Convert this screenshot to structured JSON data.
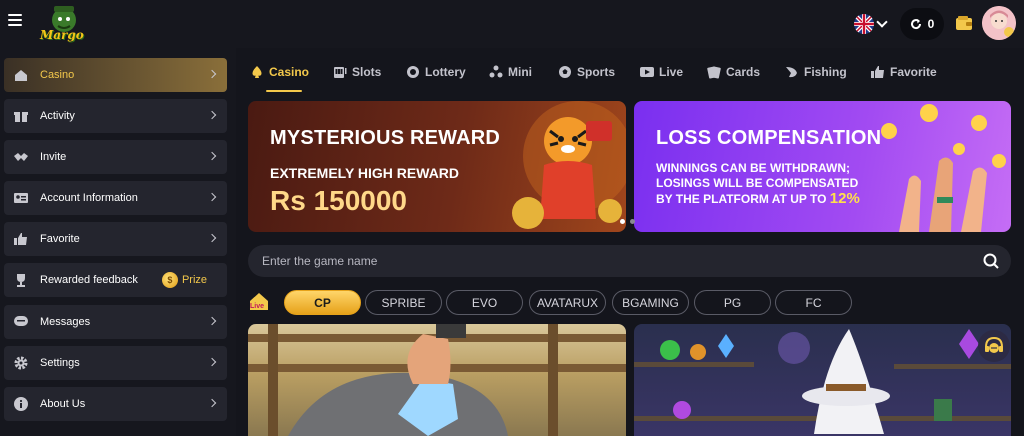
{
  "header": {
    "logo_text": "Margo",
    "language": "en-GB",
    "balance": "0"
  },
  "sidebar": {
    "items": [
      {
        "label": "Casino",
        "icon": "home-icon",
        "active": true
      },
      {
        "label": "Activity",
        "icon": "gift-icon"
      },
      {
        "label": "Invite",
        "icon": "handshake-icon"
      },
      {
        "label": "Account Information",
        "icon": "id-card-icon"
      },
      {
        "label": "Favorite",
        "icon": "thumbs-up-icon"
      },
      {
        "label": "Rewarded feedback",
        "icon": "trophy-icon",
        "badge": "Prize"
      },
      {
        "label": "Messages",
        "icon": "message-icon"
      },
      {
        "label": "Settings",
        "icon": "gear-icon"
      },
      {
        "label": "About Us",
        "icon": "info-icon"
      }
    ]
  },
  "categories": [
    {
      "label": "Casino",
      "icon": "spade-icon",
      "active": true
    },
    {
      "label": "Slots",
      "icon": "slot-machine-icon"
    },
    {
      "label": "Lottery",
      "icon": "lottery-ball-icon"
    },
    {
      "label": "Mini",
      "icon": "mini-games-icon"
    },
    {
      "label": "Sports",
      "icon": "soccer-ball-icon"
    },
    {
      "label": "Live",
      "icon": "live-video-icon"
    },
    {
      "label": "Cards",
      "icon": "cards-icon"
    },
    {
      "label": "Fishing",
      "icon": "fish-icon"
    },
    {
      "label": "Favorite",
      "icon": "thumbs-up-icon"
    }
  ],
  "banners": {
    "b1": {
      "title": "MYSTERIOUS REWARD",
      "subtitle": "EXTREMELY HIGH REWARD",
      "amount": "Rs 150000"
    },
    "b2": {
      "title": "LOSS COMPENSATION",
      "line1": "WINNINGS CAN BE WITHDRAWN;",
      "line2": "LOSINGS WILL BE COMPENSATED",
      "line3": "BY THE PLATFORM AT UP TO",
      "percent": "12%"
    }
  },
  "search": {
    "placeholder": "Enter the game name"
  },
  "providers": [
    {
      "label": "CP",
      "active": true
    },
    {
      "label": "SPRIBE"
    },
    {
      "label": "EVO"
    },
    {
      "label": "AVATARUX"
    },
    {
      "label": "BGAMING"
    },
    {
      "label": "PG"
    },
    {
      "label": "FC"
    }
  ],
  "colors": {
    "accent": "#f3c84b",
    "background": "#14151c",
    "panel": "#24252e"
  }
}
